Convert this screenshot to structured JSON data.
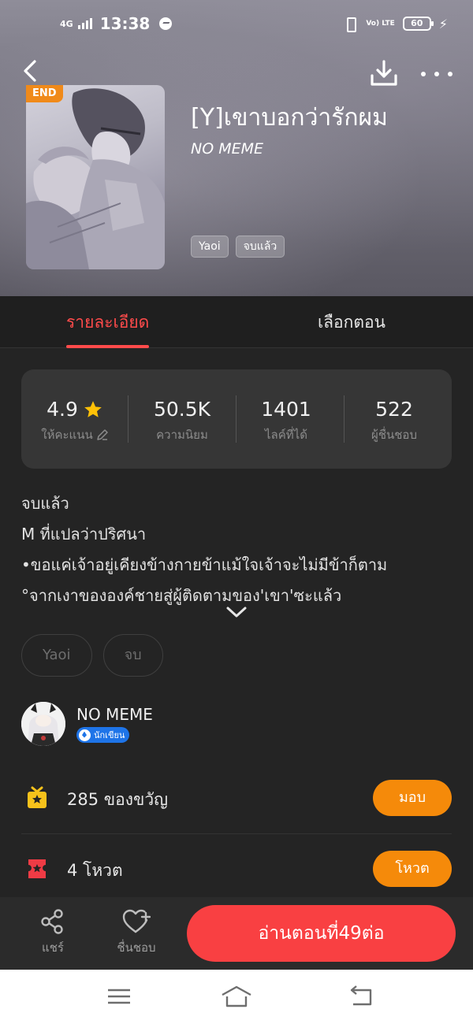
{
  "status_bar": {
    "network": "4G",
    "time": "13:38",
    "volte": "Vo) LTE",
    "battery": "60"
  },
  "book": {
    "badge": "END",
    "title": "[Y]เขาบอกว่ารักผม",
    "author": "NO MEME",
    "tags": [
      "Yaoi",
      "จบแล้ว"
    ]
  },
  "tabs": {
    "details": "รายละเอียด",
    "episodes": "เลือกตอน"
  },
  "stats": {
    "rating": {
      "value": "4.9",
      "label": "ให้คะแนน"
    },
    "popularity": {
      "value": "50.5K",
      "label": "ความนิยม"
    },
    "likes": {
      "value": "1401",
      "label": "ไลค์ที่ได้"
    },
    "fans": {
      "value": "522",
      "label": "ผู้ชื่นชอบ"
    }
  },
  "description": {
    "lines": [
      "จบแล้ว",
      "M ที่แปลว่าปริศนา",
      "•ขอแค่เจ้าอยู่เคียงข้างกายข้าแม้ใจเจ้าจะไม่มีข้าก็ตาม",
      "°จากเงาขององค์ชายสู่ผู้ติดตามของ'เขา'ซะแล้ว"
    ]
  },
  "genre_tags": [
    "Yaoi",
    "จบ"
  ],
  "author_section": {
    "name": "NO MEME",
    "badge": "นักเขียน"
  },
  "gifts": {
    "text": "285 ของขวัญ",
    "button": "มอบ"
  },
  "votes": {
    "text": "4 โหวต",
    "button": "โหวต"
  },
  "bottom_bar": {
    "share": "แชร์",
    "favorite": "ชื่นชอบ",
    "read_button": "อ่านตอนที่49ต่อ"
  },
  "colors": {
    "accent_red": "#ff4b4b",
    "read_button": "#f94042",
    "action_orange": "#f58a0a",
    "end_badge": "#f08a1a",
    "star": "#ffc107",
    "writer_badge": "#1e74e8"
  },
  "icons": [
    "back-icon",
    "download-icon",
    "more-icon",
    "star-icon",
    "edit-icon",
    "chevron-down-icon",
    "gift-icon",
    "ticket-icon",
    "share-icon",
    "heart-plus-icon",
    "menu-icon",
    "home-icon",
    "return-icon"
  ]
}
